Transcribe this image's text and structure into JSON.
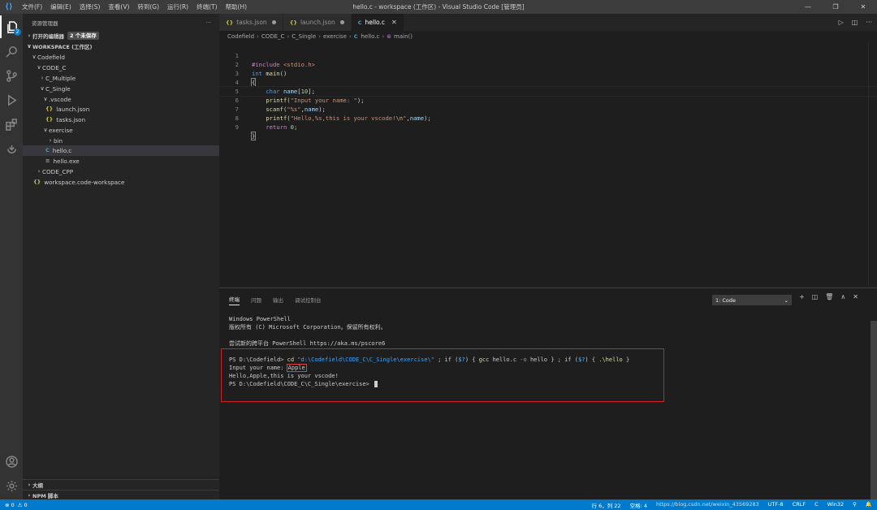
{
  "titlebar": {
    "logo": "VS Code",
    "menu": [
      "文件(F)",
      "编辑(E)",
      "选择(S)",
      "查看(V)",
      "转到(G)",
      "运行(R)",
      "终端(T)",
      "帮助(H)"
    ],
    "title": "hello.c - workspace (工作区) - Visual Studio Code [管理员]",
    "minimize": "—",
    "maximize": "❐",
    "close": "✕"
  },
  "activitybar": {
    "badge": "2",
    "icons": [
      "explorer-icon",
      "search-icon",
      "source-control-icon",
      "run-debug-icon",
      "extensions-icon",
      "remote-icon",
      "account-icon",
      "settings-gear-icon"
    ]
  },
  "sidebar": {
    "header_title": "资源管理器",
    "header_more": "···",
    "open_editors": {
      "label": "打开的编辑器",
      "badge": "2 个未保存"
    },
    "workspace": {
      "label": "WORKSPACE (工作区)"
    },
    "tree": [
      {
        "label": "Codefield",
        "chevron": "∨",
        "icon": "",
        "type": "folder"
      },
      {
        "label": "CODE_C",
        "chevron": "∨",
        "icon": "",
        "type": "folder"
      },
      {
        "label": "C_Multiple",
        "chevron": "›",
        "icon": "",
        "type": "folder"
      },
      {
        "label": "C_Single",
        "chevron": "∨",
        "icon": "",
        "type": "folder"
      },
      {
        "label": ".vscode",
        "chevron": "∨",
        "icon": "",
        "type": "folder"
      },
      {
        "label": "launch.json",
        "chevron": "",
        "icon": "{}",
        "type": "json"
      },
      {
        "label": "tasks.json",
        "chevron": "",
        "icon": "{}",
        "type": "json"
      },
      {
        "label": "exercise",
        "chevron": "∨",
        "icon": "",
        "type": "folder"
      },
      {
        "label": "bin",
        "chevron": "›",
        "icon": "",
        "type": "folder"
      },
      {
        "label": "hello.c",
        "chevron": "",
        "icon": "C",
        "type": "c"
      },
      {
        "label": "hello.exe",
        "chevron": "",
        "icon": "≡",
        "type": "exe"
      },
      {
        "label": "CODE_CPP",
        "chevron": "›",
        "icon": "",
        "type": "folder"
      },
      {
        "label": "workspace.code-workspace",
        "chevron": "",
        "icon": "{}",
        "type": "json"
      }
    ],
    "outline": {
      "label": "大纲",
      "chevron": "›"
    },
    "npm": {
      "label": "NPM 脚本",
      "chevron": "›"
    }
  },
  "tabs": [
    {
      "label": "tasks.json",
      "icon": "{}"
    },
    {
      "label": "launch.json",
      "icon": "{}"
    },
    {
      "label": "hello.c",
      "icon": "C",
      "close": "✕"
    }
  ],
  "editor_actions": {
    "run": "▷",
    "split": "◫",
    "more": "···"
  },
  "breadcrumb": {
    "items": [
      "Codefield",
      "CODE_C",
      "C_Single",
      "exercise"
    ],
    "file": "hello.c",
    "file_icon": "C",
    "symbol_icon": "⊛",
    "symbol": "main()",
    "separator": "›"
  },
  "code": {
    "line_numbers": [
      "1",
      "2",
      "3",
      "4",
      "5",
      "6",
      "7",
      "8",
      "9"
    ],
    "l1_kw": "#include",
    "l1_str": " <stdio.h>",
    "l2_kw": "int",
    "l2_fn": "main",
    "l2_rest": "()",
    "l3_brace": "{",
    "l5_kw": "char",
    "l5_var": "name",
    "l5_open": "[",
    "l5_num": "10",
    "l5_close": "];",
    "l6_fn": "printf",
    "l6_open": "(",
    "l6_str": "\"Input your name: \"",
    "l6_end": ");",
    "l7_fn": "scanf",
    "l7_open": "(",
    "l7_str": "\"%s\"",
    "l7_comma": ",",
    "l7_var": "name",
    "l7_end": ");",
    "l8_fn": "printf",
    "l8_open": "(",
    "l8_str": "\"Hello,%s,this is your vscode!",
    "l8_esc": "\\n",
    "l8_strend": "\"",
    "l8_comma": ",",
    "l8_var": "name",
    "l8_end": ");",
    "l9_kw": "return",
    "l9_num": " 0",
    "l9_end": ";",
    "l10_brace": "}"
  },
  "panel": {
    "tabs": [
      "终端",
      "问题",
      "输出",
      "调试控制台"
    ],
    "terminal_select": "1: Code",
    "select_chevron": "⌄",
    "actions": [
      "+",
      "◫",
      "🗑",
      "∧",
      "✕"
    ],
    "terminal": {
      "l1": "Windows PowerShell",
      "l2": "版权所有 (C) Microsoft Corporation。保留所有权利。",
      "l3": "尝试新的跨平台 PowerShell https://aka.ms/pscore6",
      "ps1_prompt": "PS D:\\Codefield> ",
      "ps1_cd": "cd",
      "ps1_path": " \"d:\\Codefield\\CODE_C\\C_Single\\exercise\\\"",
      "ps1_a": " ; if (",
      "ps1_v1": "$?",
      "ps1_b": ") { ",
      "ps1_gcc": "gcc",
      "ps1_c": " hello.c ",
      "ps1_o": "-o",
      "ps1_d": " hello } ; if (",
      "ps1_v2": "$?",
      "ps1_e": ") { ",
      "ps1_run": ".\\hello",
      "ps1_f": " }",
      "input_prompt": "Input your name: ",
      "input_value": "Apple",
      "output": "Hello,Apple,this is your vscode!",
      "final_prompt": "PS D:\\Codefield\\CODE_C\\C_Single\\exercise> "
    }
  },
  "statusbar": {
    "left": [
      "⊗ 0",
      "⚠ 0"
    ],
    "right": [
      "行 6，列 22",
      "空格: 4",
      "UTF-8",
      "CRLF",
      "C",
      "Win32",
      "⚲",
      "🔔"
    ],
    "watermark": "https://blog.csdn.net/weixin_43569283"
  }
}
